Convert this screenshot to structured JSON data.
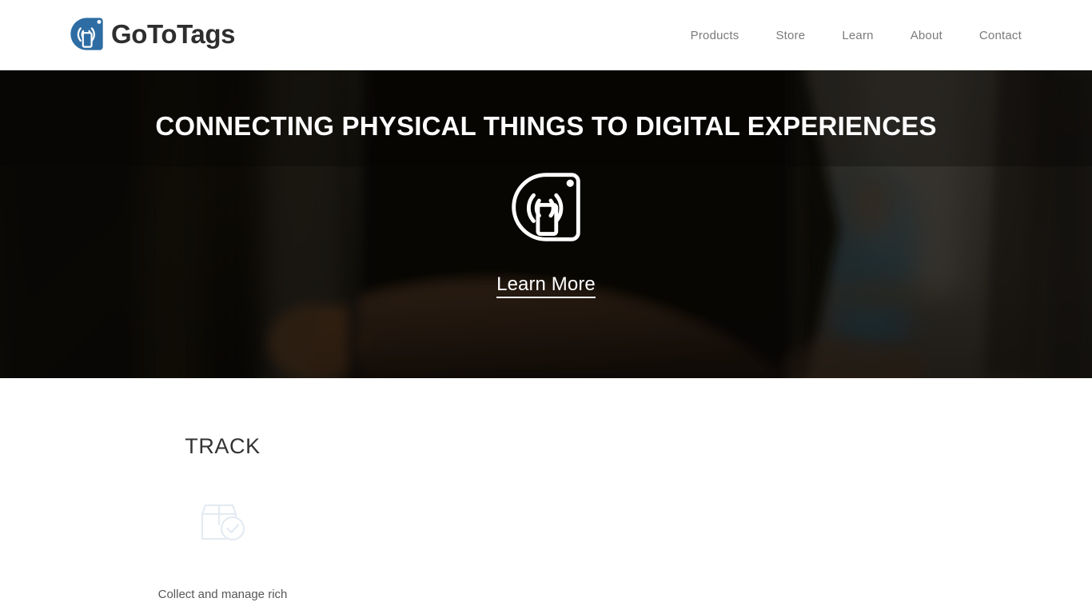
{
  "header": {
    "brand": {
      "name": "GoToTags",
      "logo_icon": "gototags-nfc-logo-icon",
      "logo_color": "#2e6da4"
    },
    "nav": [
      {
        "label": "Products"
      },
      {
        "label": "Store"
      },
      {
        "label": "Learn"
      },
      {
        "label": "About"
      },
      {
        "label": "Contact"
      }
    ]
  },
  "hero": {
    "title": "CONNECTING PHYSICAL THINGS TO DIGITAL EXPERIENCES",
    "icon": "gototags-nfc-phone-icon",
    "cta_label": "Learn More",
    "title_color": "#ffffff",
    "background_description": "dark photo of a hand holding a smartphone"
  },
  "features": [
    {
      "title": "TRACK",
      "icon": "package-check-icon",
      "description": "Collect and manage rich",
      "icon_color": "#e7edf3"
    }
  ]
}
